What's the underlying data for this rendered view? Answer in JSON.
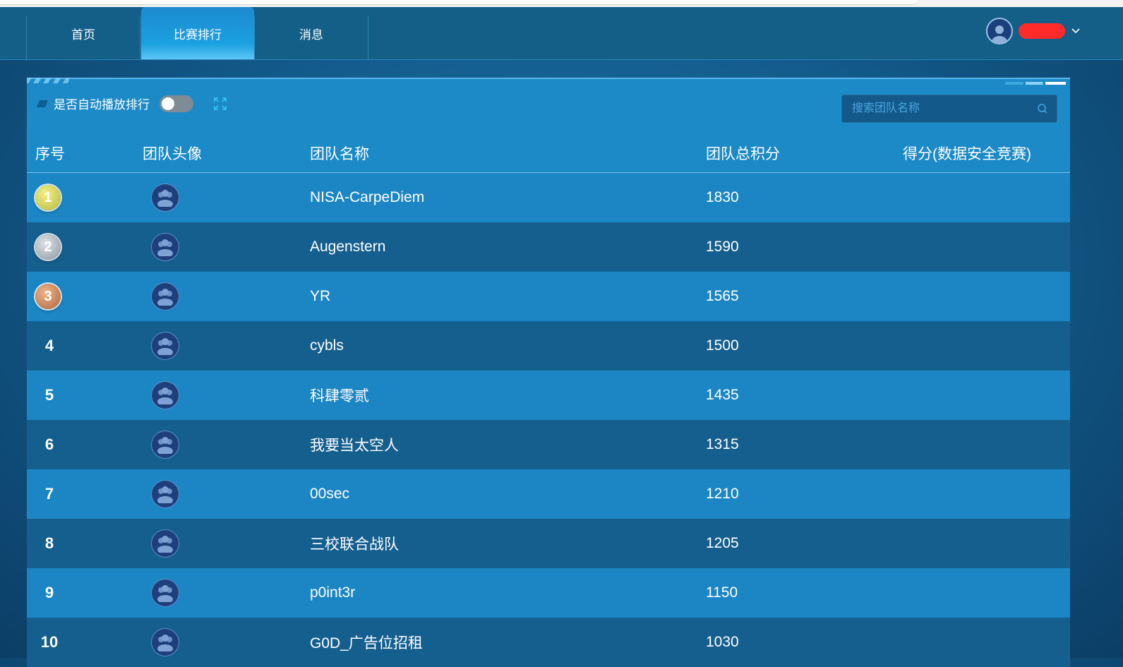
{
  "nav": {
    "items": [
      {
        "label": "首页",
        "active": false
      },
      {
        "label": "比赛排行",
        "active": true
      },
      {
        "label": "消息",
        "active": false
      }
    ]
  },
  "user": {
    "avatar_icon": "user-avatar-icon",
    "dropdown_icon": "chevron-down-icon"
  },
  "toolbar": {
    "autoplay_label": "是否自动播放排行",
    "autoplay_enabled": false,
    "fullscreen_icon": "expand-icon"
  },
  "search": {
    "placeholder": "搜索团队名称",
    "icon": "search-icon"
  },
  "table": {
    "headers": [
      "序号",
      "团队头像",
      "团队名称",
      "团队总积分",
      "得分(数据安全竞赛)"
    ],
    "rows": [
      {
        "rank": "1",
        "name": "NISA-CarpeDiem",
        "score": "1830",
        "sub_score": ""
      },
      {
        "rank": "2",
        "name": "Augenstern",
        "score": "1590",
        "sub_score": ""
      },
      {
        "rank": "3",
        "name": "YR",
        "score": "1565",
        "sub_score": ""
      },
      {
        "rank": "4",
        "name": "cybls",
        "score": "1500",
        "sub_score": ""
      },
      {
        "rank": "5",
        "name": "科肆零贰",
        "score": "1435",
        "sub_score": ""
      },
      {
        "rank": "6",
        "name": "我要当太空人",
        "score": "1315",
        "sub_score": ""
      },
      {
        "rank": "7",
        "name": "00sec",
        "score": "1210",
        "sub_score": ""
      },
      {
        "rank": "8",
        "name": "三校联合战队",
        "score": "1205",
        "sub_score": ""
      },
      {
        "rank": "9",
        "name": "p0int3r",
        "score": "1150",
        "sub_score": ""
      },
      {
        "rank": "10",
        "name": "G0D_广告位招租",
        "score": "1030",
        "sub_score": ""
      }
    ]
  },
  "colors": {
    "gold_medal": "#c9c84a",
    "silver_medal": "#a9b0b8",
    "bronze_medal": "#c9784a"
  }
}
